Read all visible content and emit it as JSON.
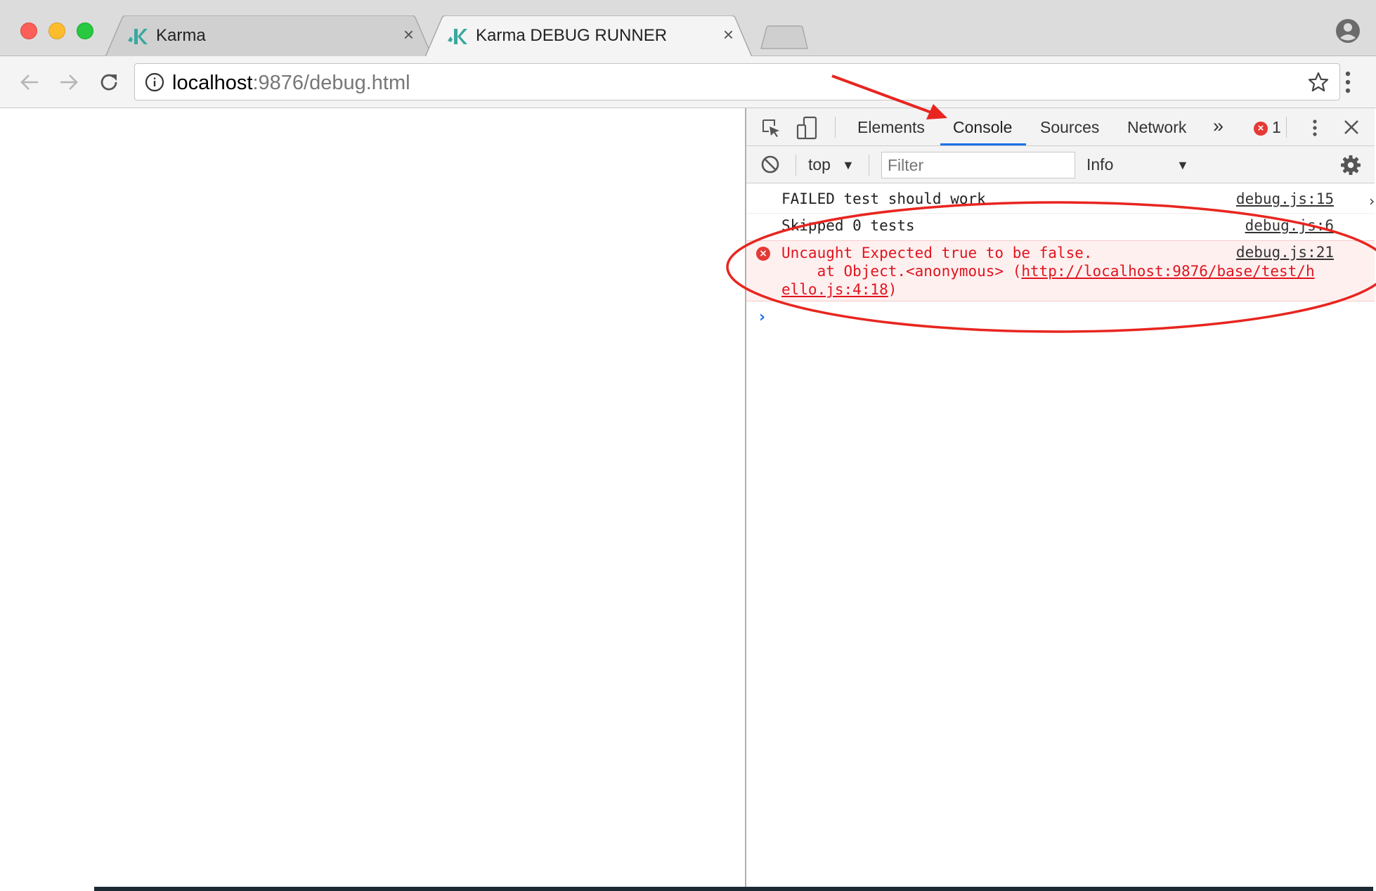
{
  "browser": {
    "tabs": [
      {
        "title": "Karma",
        "favicon": "karma-logo-icon",
        "active": false
      },
      {
        "title": "Karma DEBUG RUNNER",
        "favicon": "karma-logo-icon",
        "active": true
      }
    ],
    "close_glyph": "×",
    "address": {
      "host": "localhost",
      "rest": ":9876/debug.html"
    }
  },
  "devtools": {
    "tabs": [
      "Elements",
      "Console",
      "Sources",
      "Network"
    ],
    "more_tabs": "»",
    "error_count": "1",
    "error_glyph": "×",
    "context": "top",
    "dropdown_glyph": "▼",
    "filter_placeholder": "Filter",
    "level": "Info"
  },
  "console": {
    "messages": [
      {
        "type": "log",
        "text": "FAILED test should work",
        "source": "debug.js:15"
      },
      {
        "type": "log",
        "text": "Skipped 0 tests",
        "source": "debug.js:6"
      },
      {
        "type": "error",
        "line1": "Uncaught Expected true to be false.",
        "line2_prefix": "    at Object.<anonymous> (",
        "line2_link": "http://localhost:9876/base/test/h",
        "line3_link": "ello.js:4:18",
        "line3_suffix": ")",
        "source": "debug.js:21"
      }
    ],
    "prompt": "›"
  },
  "colors": {
    "accent": "#1a73e8",
    "error": "#e0141e",
    "error_bg": "#fff0f0",
    "annotation": "#e8251f"
  }
}
